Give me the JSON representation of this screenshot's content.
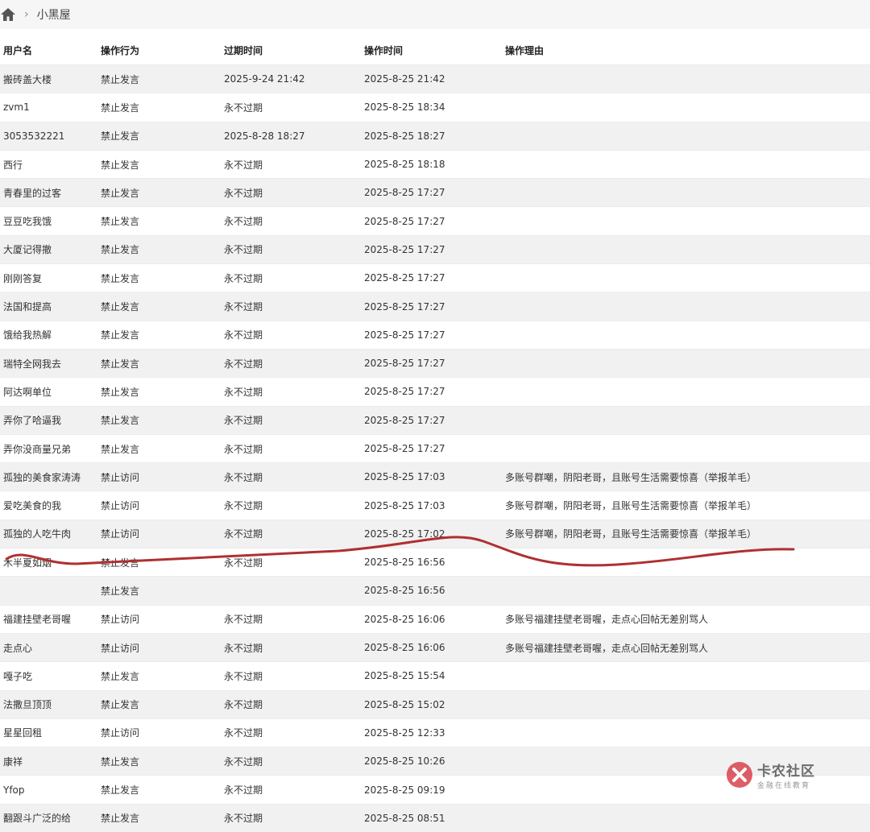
{
  "breadcrumb": {
    "separator": "›",
    "current": "小黑屋",
    "home_icon": "home-icon"
  },
  "table": {
    "headers": [
      "用户名",
      "操作行为",
      "过期时间",
      "操作时间",
      "操作理由"
    ],
    "rows": [
      [
        "搬砖盖大楼",
        "禁止发言",
        "2025-9-24 21:42",
        "2025-8-25 21:42",
        ""
      ],
      [
        "zvm1",
        "禁止发言",
        "永不过期",
        "2025-8-25 18:34",
        ""
      ],
      [
        "3053532221",
        "禁止发言",
        "2025-8-28 18:27",
        "2025-8-25 18:27",
        ""
      ],
      [
        "西行",
        "禁止发言",
        "永不过期",
        "2025-8-25 18:18",
        ""
      ],
      [
        "青春里的过客",
        "禁止发言",
        "永不过期",
        "2025-8-25 17:27",
        ""
      ],
      [
        "豆豆吃我饿",
        "禁止发言",
        "永不过期",
        "2025-8-25 17:27",
        ""
      ],
      [
        "大厦记得撤",
        "禁止发言",
        "永不过期",
        "2025-8-25 17:27",
        ""
      ],
      [
        "刚刚答复",
        "禁止发言",
        "永不过期",
        "2025-8-25 17:27",
        ""
      ],
      [
        "法国和提高",
        "禁止发言",
        "永不过期",
        "2025-8-25 17:27",
        ""
      ],
      [
        "饿给我热解",
        "禁止发言",
        "永不过期",
        "2025-8-25 17:27",
        ""
      ],
      [
        "瑞特全网我去",
        "禁止发言",
        "永不过期",
        "2025-8-25 17:27",
        ""
      ],
      [
        "阿达啊单位",
        "禁止发言",
        "永不过期",
        "2025-8-25 17:27",
        ""
      ],
      [
        "弄你了哈逼我",
        "禁止发言",
        "永不过期",
        "2025-8-25 17:27",
        ""
      ],
      [
        "弄你没商量兄弟",
        "禁止发言",
        "永不过期",
        "2025-8-25 17:27",
        ""
      ],
      [
        "孤独的美食家涛涛",
        "禁止访问",
        "永不过期",
        "2025-8-25 17:03",
        "多账号群嘲，阴阳老哥，且账号生活需要惊喜（举报羊毛）"
      ],
      [
        "爱吃美食的我",
        "禁止访问",
        "永不过期",
        "2025-8-25 17:03",
        "多账号群嘲，阴阳老哥，且账号生活需要惊喜（举报羊毛）"
      ],
      [
        "孤独的人吃牛肉",
        "禁止访问",
        "永不过期",
        "2025-8-25 17:02",
        "多账号群嘲，阴阳老哥，且账号生活需要惊喜（举报羊毛）"
      ],
      [
        "木半夏如烟",
        "禁止发言",
        "永不过期",
        "2025-8-25 16:56",
        ""
      ],
      [
        "",
        "禁止发言",
        "",
        "2025-8-25 16:56",
        ""
      ],
      [
        "福建挂壁老哥喔",
        "禁止访问",
        "永不过期",
        "2025-8-25 16:06",
        "多账号福建挂壁老哥喔，走点心回帖无差别骂人"
      ],
      [
        "走点心",
        "禁止访问",
        "永不过期",
        "2025-8-25 16:06",
        "多账号福建挂壁老哥喔，走点心回帖无差别骂人"
      ],
      [
        "嘎子吃",
        "禁止发言",
        "永不过期",
        "2025-8-25 15:54",
        ""
      ],
      [
        "法撒旦顶顶",
        "禁止发言",
        "永不过期",
        "2025-8-25 15:02",
        ""
      ],
      [
        "星星回租",
        "禁止访问",
        "永不过期",
        "2025-8-25 12:33",
        ""
      ],
      [
        "康祥",
        "禁止发言",
        "永不过期",
        "2025-8-25 10:26",
        ""
      ],
      [
        "Yfop",
        "禁止发言",
        "永不过期",
        "2025-8-25 09:19",
        ""
      ],
      [
        "翻跟斗广泛的给",
        "禁止发言",
        "永不过期",
        "2025-8-25 08:51",
        ""
      ]
    ]
  },
  "watermark": {
    "title": "卡农社区",
    "subtitle": "金融在线教育",
    "logo_icon": "kanong-logo-icon"
  },
  "annotation": {
    "stroke_color": "#b03030"
  },
  "colors": {
    "row_alt": "#f1f1f1",
    "breadcrumb_bg": "#f6f6f6",
    "logo_red": "#d9434e"
  }
}
